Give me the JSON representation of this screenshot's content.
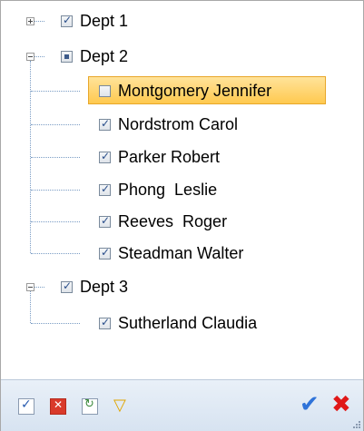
{
  "tree": {
    "items": [
      {
        "label": "Dept 1",
        "check": "checked",
        "expanded": false
      },
      {
        "label": "Dept 2",
        "check": "partial",
        "expanded": true
      },
      {
        "label": "Montgomery Jennifer",
        "check": "unchecked",
        "selected": true
      },
      {
        "label": "Nordstrom Carol",
        "check": "checked"
      },
      {
        "label": "Parker Robert",
        "check": "checked"
      },
      {
        "label": "Phong  Leslie",
        "check": "checked"
      },
      {
        "label": "Reeves  Roger",
        "check": "checked"
      },
      {
        "label": "Steadman Walter",
        "check": "checked"
      },
      {
        "label": "Dept 3",
        "check": "checked",
        "expanded": true
      },
      {
        "label": "Sutherland Claudia",
        "check": "checked"
      }
    ]
  },
  "toolbar": {
    "icons": [
      "check-all-icon",
      "uncheck-all-icon",
      "invert-selection-icon",
      "filter-icon",
      "ok-icon",
      "cancel-icon"
    ],
    "colors": {
      "ok": "#2f73d9",
      "cancel": "#e01818",
      "filter": "#e0a500",
      "selection": "#ffc94f"
    }
  }
}
